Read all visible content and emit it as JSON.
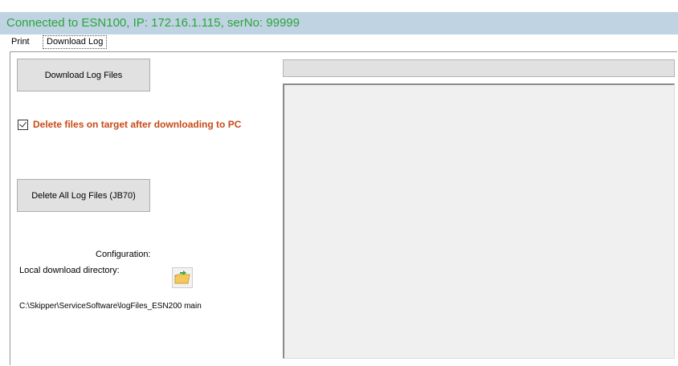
{
  "status": {
    "text": "Connected to ESN100, IP: 172.16.1.115, serNo: 99999",
    "color": "#2aa53a"
  },
  "menu": {
    "items": [
      {
        "label": "Print"
      },
      {
        "label": "Download Log"
      }
    ]
  },
  "panel": {
    "download_button": "Download Log Files",
    "delete_checkbox": {
      "label": "Delete files on target after downloading to PC",
      "checked": true
    },
    "delete_all_button": "Delete All Log Files (JB70)",
    "configuration_label": "Configuration:",
    "local_dir_label": "Local download directory:",
    "folder_icon": "open-folder-icon",
    "directory_path": "C:\\Skipper\\ServiceSoftware\\logFiles_ESN200 main"
  },
  "colors": {
    "status_bar_bg": "#bfd3e2",
    "accent_orange": "#c84a16"
  }
}
